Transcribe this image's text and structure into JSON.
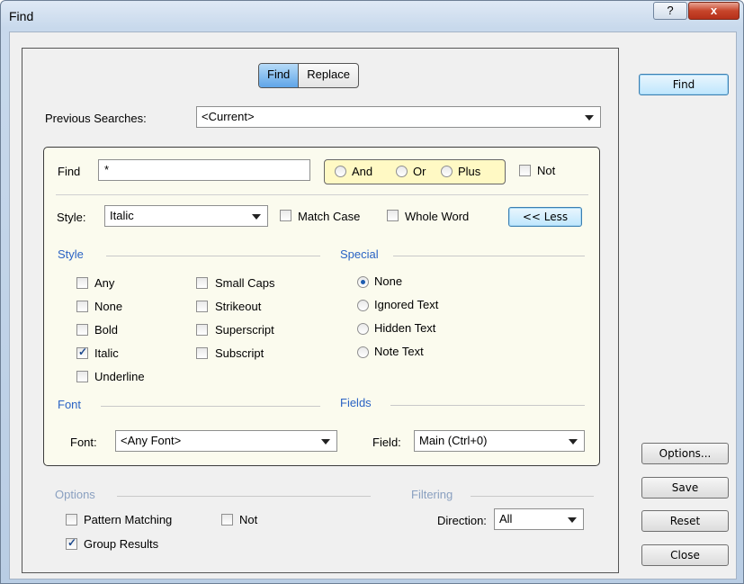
{
  "window": {
    "title": "Find",
    "help_glyph": "?",
    "close_glyph": "x"
  },
  "tabs": [
    {
      "label": "Find"
    },
    {
      "label": "Replace"
    }
  ],
  "right_buttons": {
    "find": "Find",
    "options": "Options...",
    "save": "Save",
    "reset": "Reset",
    "close": "Close"
  },
  "previous": {
    "label": "Previous Searches:",
    "value": "<Current>"
  },
  "find_row": {
    "label": "Find",
    "value": "*",
    "and": "And",
    "or": "Or",
    "plus": "Plus",
    "not": "Not"
  },
  "style_row": {
    "label": "Style:",
    "value": "Italic",
    "match_case": "Match Case",
    "whole_word": "Whole Word",
    "less": "<< Less"
  },
  "style_section": {
    "title": "Style",
    "col1": [
      {
        "label": "Any",
        "checked": false
      },
      {
        "label": "None",
        "checked": false
      },
      {
        "label": "Bold",
        "checked": false
      },
      {
        "label": "Italic",
        "checked": true
      },
      {
        "label": "Underline",
        "checked": false
      }
    ],
    "col2": [
      {
        "label": "Small Caps",
        "checked": false
      },
      {
        "label": "Strikeout",
        "checked": false
      },
      {
        "label": "Superscript",
        "checked": false
      },
      {
        "label": "Subscript",
        "checked": false
      }
    ]
  },
  "special_section": {
    "title": "Special",
    "items": [
      {
        "label": "None",
        "selected": true
      },
      {
        "label": "Ignored Text",
        "selected": false
      },
      {
        "label": "Hidden Text",
        "selected": false
      },
      {
        "label": "Note Text",
        "selected": false
      }
    ]
  },
  "font_section": {
    "title": "Font",
    "label": "Font:",
    "value": "<Any Font>"
  },
  "fields_section": {
    "title": "Fields",
    "label": "Field:",
    "value": "Main  (Ctrl+0)"
  },
  "options_section": {
    "title": "Options",
    "pattern": "Pattern Matching",
    "not": "Not",
    "group": "Group Results"
  },
  "filtering_section": {
    "title": "Filtering",
    "label": "Direction:",
    "value": "All"
  }
}
